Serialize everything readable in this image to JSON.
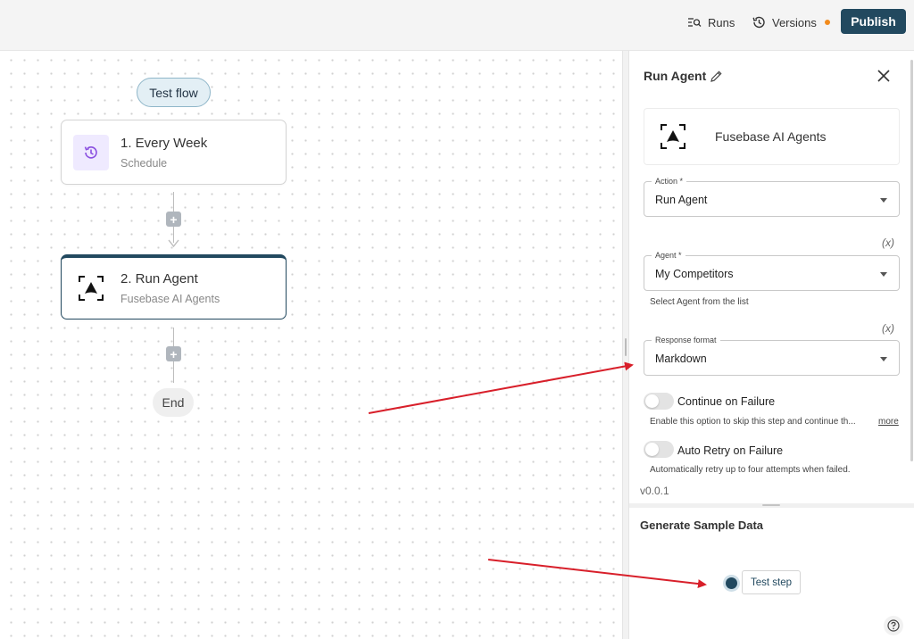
{
  "topbar": {
    "runs_label": "Runs",
    "versions_label": "Versions",
    "publish_label": "Publish",
    "versions_dot_color": "#f28b1c"
  },
  "canvas": {
    "test_flow_label": "Test flow",
    "steps": [
      {
        "title": "1. Every Week",
        "subtitle": "Schedule",
        "icon": "clock-refresh-icon"
      },
      {
        "title": "2. Run Agent",
        "subtitle": "Fusebase AI Agents",
        "icon": "fusebase-agent-icon"
      }
    ],
    "end_label": "End",
    "add_step_symbol": "+"
  },
  "panel": {
    "title": "Run Agent",
    "piece_name": "Fusebase AI Agents",
    "action": {
      "label": "Action *",
      "value": "Run Agent"
    },
    "agent": {
      "label": "Agent *",
      "value": "My Competitors",
      "helper": "Select Agent from the list"
    },
    "response_format": {
      "label": "Response format",
      "value": "Markdown"
    },
    "fx_label": "(x)",
    "continue_on_failure": {
      "label": "Continue on Failure",
      "helper": "Enable this option to skip this step and continue th...",
      "more": "more"
    },
    "auto_retry": {
      "label": "Auto Retry on Failure",
      "helper": "Automatically retry up to four attempts when failed."
    },
    "version": "v0.0.1",
    "sample_data_title": "Generate Sample Data",
    "test_step_label": "Test step"
  },
  "colors": {
    "brand": "#22495f",
    "annotation_arrow": "#d81f2a"
  }
}
